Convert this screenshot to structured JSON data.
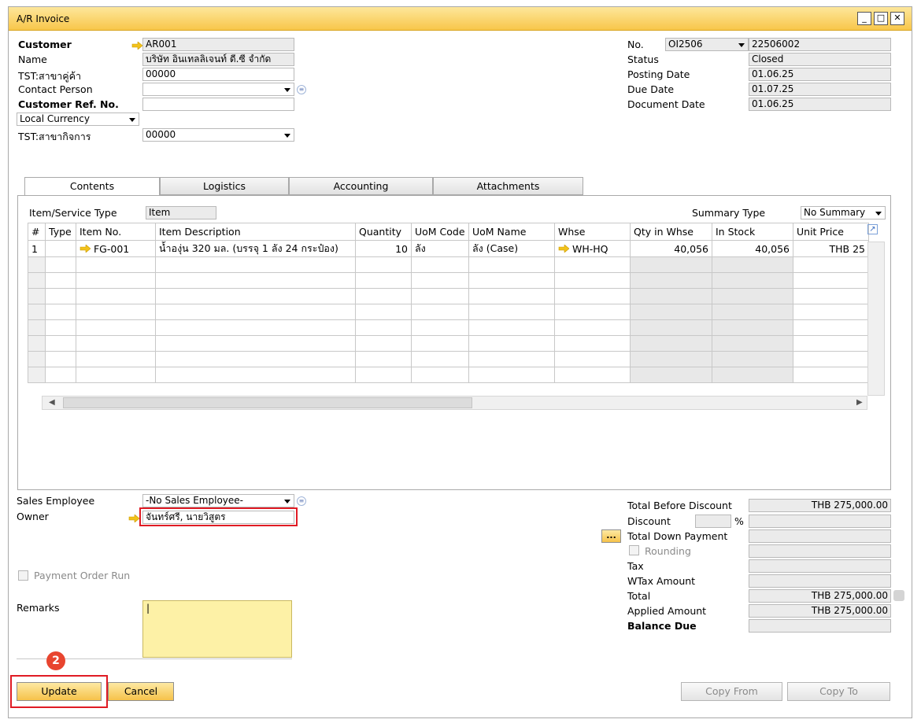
{
  "window": {
    "title": "A/R Invoice"
  },
  "header_left": {
    "customer_label": "Customer",
    "customer_value": "AR001",
    "name_label": "Name",
    "name_value": "บริษัท อินเทลลิเจนท์ ดี.ซี จำกัด",
    "branch_label": "TST:สาขาคู่ค้า",
    "branch_value": "00000",
    "contact_label": "Contact Person",
    "contact_value": "",
    "custref_label": "Customer Ref. No.",
    "custref_value": "",
    "currency_value": "Local Currency",
    "bizbranch_label": "TST:สาขากิจการ",
    "bizbranch_value": "00000"
  },
  "header_right": {
    "no_label": "No.",
    "series": "OI2506",
    "doc_no": "22506002",
    "status_label": "Status",
    "status_value": "Closed",
    "posting_label": "Posting Date",
    "posting_value": "01.06.25",
    "due_label": "Due Date",
    "due_value": "01.07.25",
    "docdate_label": "Document Date",
    "docdate_value": "01.06.25"
  },
  "tabs": [
    "Contents",
    "Logistics",
    "Accounting",
    "Attachments"
  ],
  "contents": {
    "type_label": "Item/Service Type",
    "type_value": "Item",
    "summary_label": "Summary Type",
    "summary_value": "No Summary",
    "columns": [
      "#",
      "Type",
      "Item No.",
      "Item Description",
      "Quantity",
      "UoM Code",
      "UoM Name",
      "Whse",
      "Qty in Whse",
      "In Stock",
      "Unit Price"
    ],
    "rows": [
      [
        "1",
        "",
        "FG-001",
        "น้ำองุ่น 320 มล. (บรรจุ 1 ลัง 24 กระป๋อง)",
        "10",
        "ลัง",
        "ลัง (Case)",
        "WH-HQ",
        "40,056",
        "40,056",
        "THB 25"
      ]
    ]
  },
  "footer_left": {
    "sales_emp_label": "Sales Employee",
    "sales_emp_value": "-No Sales Employee-",
    "owner_label": "Owner",
    "owner_value": "จันทร์ศรี, นายวิสูตร",
    "payment_run_label": "Payment Order Run",
    "remarks_label": "Remarks",
    "remarks_value": "|"
  },
  "totals": {
    "before_discount_label": "Total Before Discount",
    "before_discount_value": "THB 275,000.00",
    "discount_label": "Discount",
    "discount_pct": "",
    "percent_sign": "%",
    "discount_value": "",
    "down_payment_label": "Total Down Payment",
    "down_payment_btn": "...",
    "rounding_label": "Rounding",
    "tax_label": "Tax",
    "wtax_label": "WTax Amount",
    "total_label": "Total",
    "total_value": "THB 275,000.00",
    "applied_label": "Applied Amount",
    "applied_value": "THB 275,000.00",
    "balance_label": "Balance Due",
    "balance_value": ""
  },
  "buttons": {
    "update": "Update",
    "cancel": "Cancel",
    "copy_from": "Copy From",
    "copy_to": "Copy To"
  },
  "annotation": {
    "step": "2"
  },
  "colors": {
    "accent": "#f6c24a",
    "highlight_red": "#e01b24",
    "link_arrow": "#f2c21b",
    "readonly": "#ebebeb"
  }
}
